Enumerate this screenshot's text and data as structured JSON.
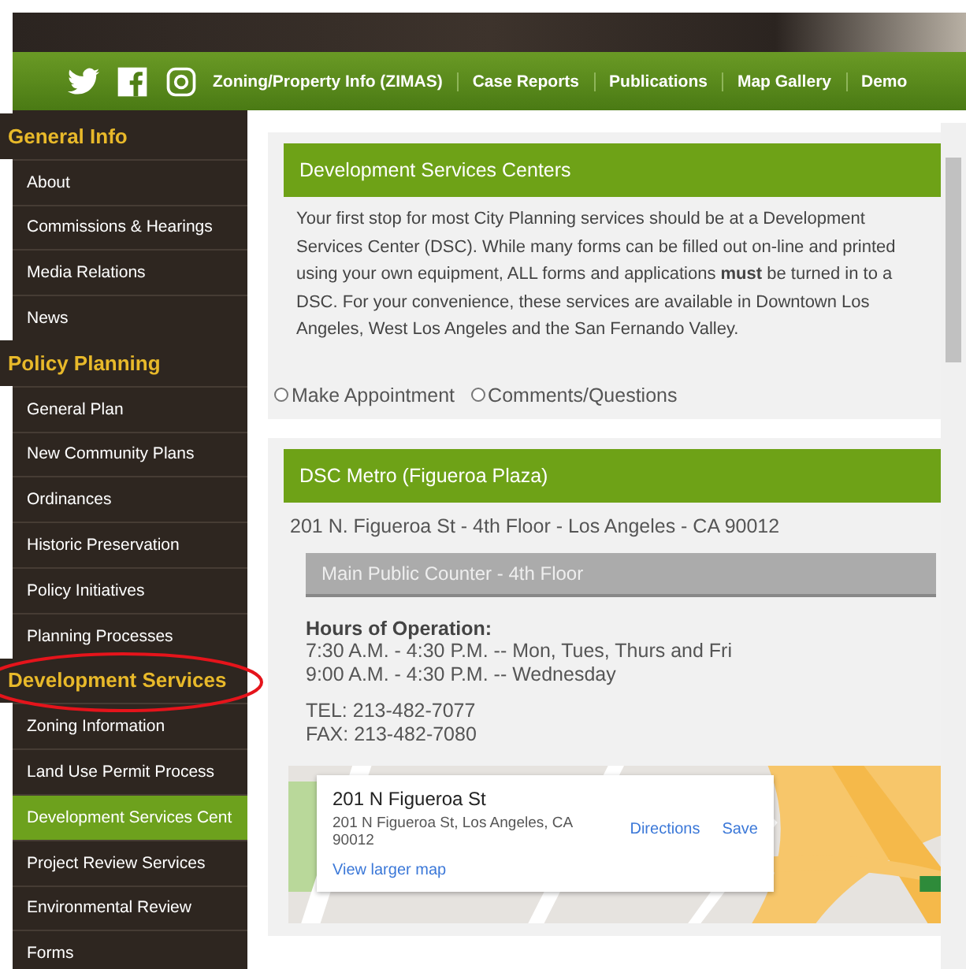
{
  "nav": {
    "items": [
      {
        "label": "Zoning/Property Info (ZIMAS)"
      },
      {
        "label": "Case Reports"
      },
      {
        "label": "Publications"
      },
      {
        "label": "Map Gallery"
      },
      {
        "label": "Demo"
      }
    ]
  },
  "sidebar": {
    "items": [
      {
        "kind": "heading",
        "label": "General Info",
        "selected": false
      },
      {
        "kind": "link",
        "label": "About",
        "selected": false
      },
      {
        "kind": "link",
        "label": "Commissions & Hearings",
        "selected": false
      },
      {
        "kind": "link",
        "label": "Media Relations",
        "selected": false
      },
      {
        "kind": "link",
        "label": "News",
        "selected": false
      },
      {
        "kind": "heading",
        "label": "Policy Planning",
        "selected": false
      },
      {
        "kind": "link",
        "label": "General Plan",
        "selected": false
      },
      {
        "kind": "link",
        "label": "New Community Plans",
        "selected": false
      },
      {
        "kind": "link",
        "label": "Ordinances",
        "selected": false
      },
      {
        "kind": "link",
        "label": "Historic Preservation",
        "selected": false
      },
      {
        "kind": "link",
        "label": "Policy Initiatives",
        "selected": false
      },
      {
        "kind": "link",
        "label": "Planning Processes",
        "selected": false
      },
      {
        "kind": "heading",
        "label": "Development Services",
        "selected": false
      },
      {
        "kind": "link",
        "label": "Zoning Information",
        "selected": false
      },
      {
        "kind": "link",
        "label": "Land Use Permit Process",
        "selected": false
      },
      {
        "kind": "link",
        "label": "Development Services Cent",
        "selected": true
      },
      {
        "kind": "link",
        "label": "Project Review Services",
        "selected": false
      },
      {
        "kind": "link",
        "label": "Environmental Review",
        "selected": false
      },
      {
        "kind": "link",
        "label": "Forms",
        "selected": false
      }
    ]
  },
  "centers": {
    "title": "Development Services Centers",
    "text": "Your first stop for most City Planning services should be at a Development Services Center (DSC). While many forms can be filled out on-line and printed using your own equipment, ALL forms and applications **must** be turned in to a DSC. For your convenience, these services are available in Downtown Los Angeles, West Los Angeles and the San Fernando Valley.",
    "options": [
      {
        "label": "Make Appointment",
        "selected": false
      },
      {
        "label": "Comments/Questions",
        "selected": false
      }
    ]
  },
  "metro": {
    "title": "DSC Metro (Figueroa Plaza)",
    "address": "201 N. Figueroa St - 4th Floor - Los Angeles - CA 90012",
    "counter": "Main Public Counter - 4th Floor",
    "hours_title": "Hours of Operation:",
    "hours": [
      "7:30 A.M. - 4:30 P.M. -- Mon, Tues, Thurs and Fri",
      "9:00 A.M. - 4:30 P.M. -- Wednesday"
    ],
    "phones": [
      "TEL: 213-482-7077",
      "FAX: 213-482-7080"
    ],
    "map": {
      "kind": "picture",
      "card": {
        "title": "201 N Figueroa St",
        "address": "201 N Figueroa St, Los Angeles, CA 90012",
        "directions": "Directions",
        "save": "Save",
        "larger": "View larger map"
      }
    }
  }
}
